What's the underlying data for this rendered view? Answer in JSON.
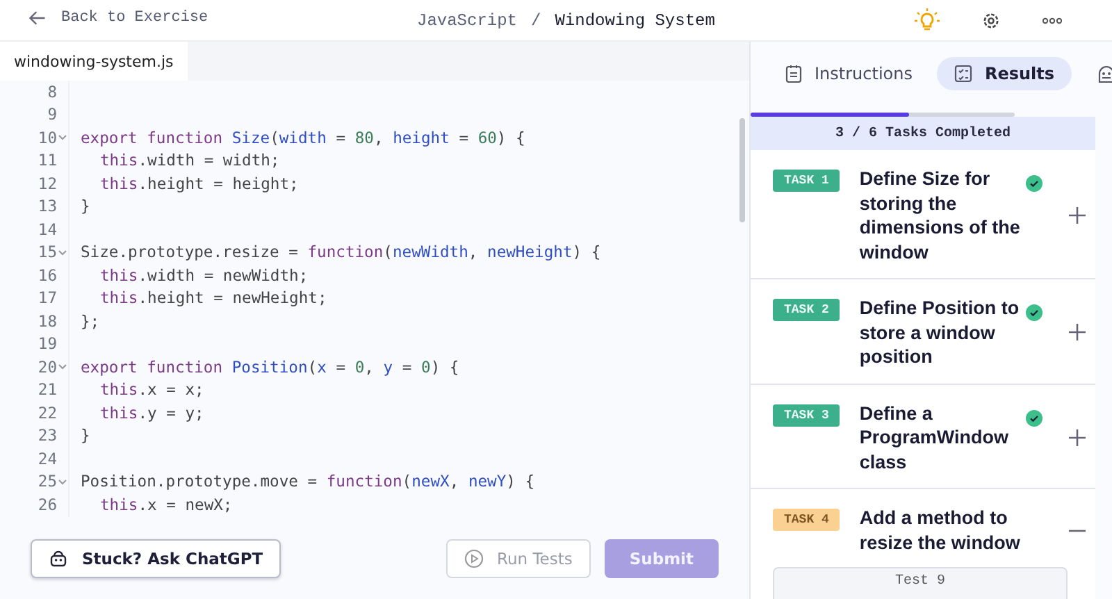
{
  "header": {
    "back": "Back to Exercise",
    "track": "JavaScript",
    "separator": "/",
    "exercise": "Windowing System"
  },
  "editor": {
    "file_tab": {
      "label": "windowing-system.js",
      "selected": true
    },
    "lines": [
      {
        "number": "8",
        "foldable": false
      },
      {
        "number": "9",
        "foldable": false
      },
      {
        "number": "10",
        "foldable": true,
        "indent": false,
        "tokens": [
          {
            "kind": "keyword",
            "text": "export function"
          },
          {
            "kind": "function",
            "text": "Size"
          },
          {
            "kind": "plain",
            "text": "("
          },
          {
            "kind": "param",
            "text": "width"
          },
          {
            "kind": "plain",
            "text": "="
          },
          {
            "kind": "number",
            "text": "80"
          },
          {
            "kind": "plain",
            "text": ","
          },
          {
            "kind": "param",
            "text": "height"
          },
          {
            "kind": "plain",
            "text": "="
          },
          {
            "kind": "number",
            "text": "60"
          },
          {
            "kind": "plain",
            "text": ") {"
          }
        ]
      },
      {
        "number": "11",
        "foldable": false,
        "indent": true,
        "tokens": [
          {
            "kind": "keyword",
            "text": "this"
          },
          {
            "kind": "plain",
            "text": ".width = width;"
          }
        ]
      },
      {
        "number": "12",
        "foldable": false,
        "indent": true,
        "tokens": [
          {
            "kind": "keyword",
            "text": "this"
          },
          {
            "kind": "plain",
            "text": ".height = height;"
          }
        ]
      },
      {
        "number": "13",
        "foldable": false,
        "indent": false,
        "tokens": [
          {
            "kind": "plain",
            "text": "}"
          }
        ]
      },
      {
        "number": "14",
        "foldable": false
      },
      {
        "number": "15",
        "foldable": true,
        "indent": false,
        "tokens": [
          {
            "kind": "plain",
            "text": "Size.prototype.resize ="
          },
          {
            "kind": "keyword",
            "text": "function"
          },
          {
            "kind": "plain",
            "text": "("
          },
          {
            "kind": "param",
            "text": "newWidth"
          },
          {
            "kind": "plain",
            "text": ","
          },
          {
            "kind": "param",
            "text": "newHeight"
          },
          {
            "kind": "plain",
            "text": ") {"
          }
        ]
      },
      {
        "number": "16",
        "foldable": false,
        "indent": true,
        "tokens": [
          {
            "kind": "keyword",
            "text": "this"
          },
          {
            "kind": "plain",
            "text": ".width = newWidth;"
          }
        ]
      },
      {
        "number": "17",
        "foldable": false,
        "indent": true,
        "tokens": [
          {
            "kind": "keyword",
            "text": "this"
          },
          {
            "kind": "plain",
            "text": ".height = newHeight;"
          }
        ]
      },
      {
        "number": "18",
        "foldable": false,
        "indent": false,
        "tokens": [
          {
            "kind": "plain",
            "text": "};"
          }
        ]
      },
      {
        "number": "19",
        "foldable": false
      },
      {
        "number": "20",
        "foldable": true,
        "indent": false,
        "tokens": [
          {
            "kind": "keyword",
            "text": "export function"
          },
          {
            "kind": "function",
            "text": "Position"
          },
          {
            "kind": "plain",
            "text": "("
          },
          {
            "kind": "param",
            "text": "x"
          },
          {
            "kind": "plain",
            "text": "="
          },
          {
            "kind": "number",
            "text": "0"
          },
          {
            "kind": "plain",
            "text": ","
          },
          {
            "kind": "param",
            "text": "y"
          },
          {
            "kind": "plain",
            "text": "="
          },
          {
            "kind": "number",
            "text": "0"
          },
          {
            "kind": "plain",
            "text": ") {"
          }
        ]
      },
      {
        "number": "21",
        "foldable": false,
        "indent": true,
        "tokens": [
          {
            "kind": "keyword",
            "text": "this"
          },
          {
            "kind": "plain",
            "text": ".x = x;"
          }
        ]
      },
      {
        "number": "22",
        "foldable": false,
        "indent": true,
        "tokens": [
          {
            "kind": "keyword",
            "text": "this"
          },
          {
            "kind": "plain",
            "text": ".y = y;"
          }
        ]
      },
      {
        "number": "23",
        "foldable": false,
        "indent": false,
        "tokens": [
          {
            "kind": "plain",
            "text": "}"
          }
        ]
      },
      {
        "number": "24",
        "foldable": false
      },
      {
        "number": "25",
        "foldable": true,
        "indent": false,
        "tokens": [
          {
            "kind": "plain",
            "text": "Position.prototype.move ="
          },
          {
            "kind": "keyword",
            "text": "function"
          },
          {
            "kind": "plain",
            "text": "("
          },
          {
            "kind": "param",
            "text": "newX"
          },
          {
            "kind": "plain",
            "text": ","
          },
          {
            "kind": "param",
            "text": "newY"
          },
          {
            "kind": "plain",
            "text": ") {"
          }
        ]
      },
      {
        "number": "26",
        "foldable": false,
        "indent": true,
        "tokens": [
          {
            "kind": "keyword",
            "text": "this"
          },
          {
            "kind": "plain",
            "text": ".x = newX;"
          }
        ]
      }
    ]
  },
  "actions": {
    "help": "Stuck? Ask ChatGPT",
    "run": {
      "label": "Run Tests",
      "disabled": true
    },
    "submit": {
      "label": "Submit",
      "disabled": true
    }
  },
  "panel": {
    "tabs": [
      {
        "kind": "instructions",
        "label": "Instructions",
        "selected": false
      },
      {
        "kind": "results",
        "label": "Results",
        "selected": true
      },
      {
        "kind": "bot",
        "selected": false
      }
    ],
    "progress": {
      "level": 0.6
    },
    "summary": "3 / 6 Tasks Completed",
    "tasks": [
      {
        "tag": "TASK 1",
        "title": "Define Size for storing the dimensions of the window",
        "completed": true,
        "expanded": false
      },
      {
        "tag": "TASK 2",
        "title": "Define Position to store a window position",
        "completed": true,
        "expanded": false
      },
      {
        "tag": "TASK 3",
        "title": "Define a ProgramWindow class",
        "completed": true,
        "expanded": false
      },
      {
        "tag": "TASK 4",
        "title": "Add a method to resize the window",
        "completed": false,
        "expanded": true,
        "tests": [
          "Test 9"
        ]
      }
    ]
  }
}
